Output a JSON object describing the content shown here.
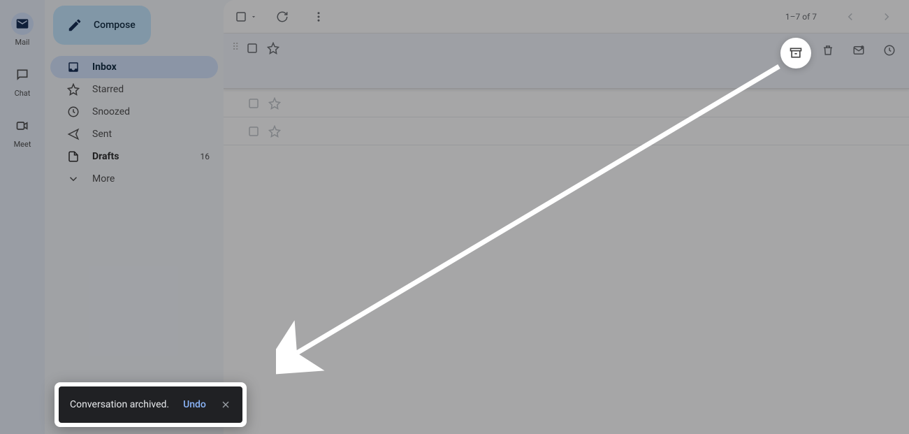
{
  "apprail": {
    "mail": "Mail",
    "chat": "Chat",
    "meet": "Meet"
  },
  "compose_label": "Compose",
  "nav": {
    "inbox": "Inbox",
    "starred": "Starred",
    "snoozed": "Snoozed",
    "sent": "Sent",
    "drafts": "Drafts",
    "drafts_count": "16",
    "more": "More"
  },
  "toolbar": {
    "page_count": "1–7 of 7"
  },
  "toast": {
    "message": "Conversation archived.",
    "undo": "Undo"
  },
  "icons": {
    "archive": "archive-icon",
    "delete": "trash-icon",
    "markunread": "mark-unread-icon",
    "snooze": "clock-icon"
  }
}
